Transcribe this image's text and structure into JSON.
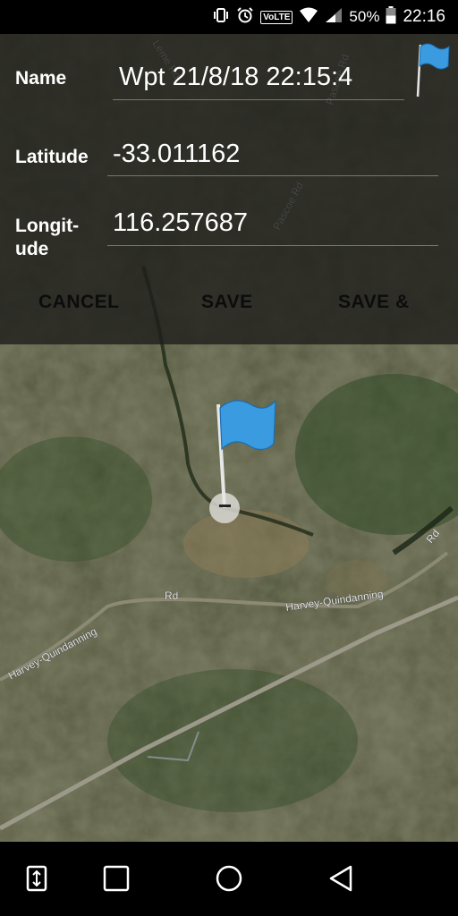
{
  "status_bar": {
    "volte": "VoLTE",
    "battery_percent": "50%",
    "time": "22:16",
    "icons": [
      "vibrate-icon",
      "alarm-icon",
      "volte-badge",
      "wifi-icon",
      "signal-icon",
      "battery-icon"
    ]
  },
  "dialog": {
    "name_label": "Name",
    "name_value": "Wpt 21/8/18 22:15:4",
    "latitude_label": "Latitude",
    "latitude_value": "-33.011162",
    "longitude_label": "Longit-ude",
    "longitude_value": "116.257687",
    "cancel_label": "CANCEL",
    "save_label": "SAVE",
    "save_and_label": "SAVE &",
    "flag_color": "#3a9be0"
  },
  "map": {
    "roads": [
      "Leme Rd",
      "Pascoe Rd",
      "Pascoe Rd",
      "Rd",
      "Harvey-Quindanning",
      "Rd",
      "Harvey-Quindanning",
      "Rd",
      "Harvey-Quindanning"
    ],
    "marker_icon": "waypoint-flag-icon"
  },
  "nav_bar": {
    "icons": [
      "screen-toggle-icon",
      "recents-icon",
      "home-icon",
      "back-icon"
    ]
  }
}
